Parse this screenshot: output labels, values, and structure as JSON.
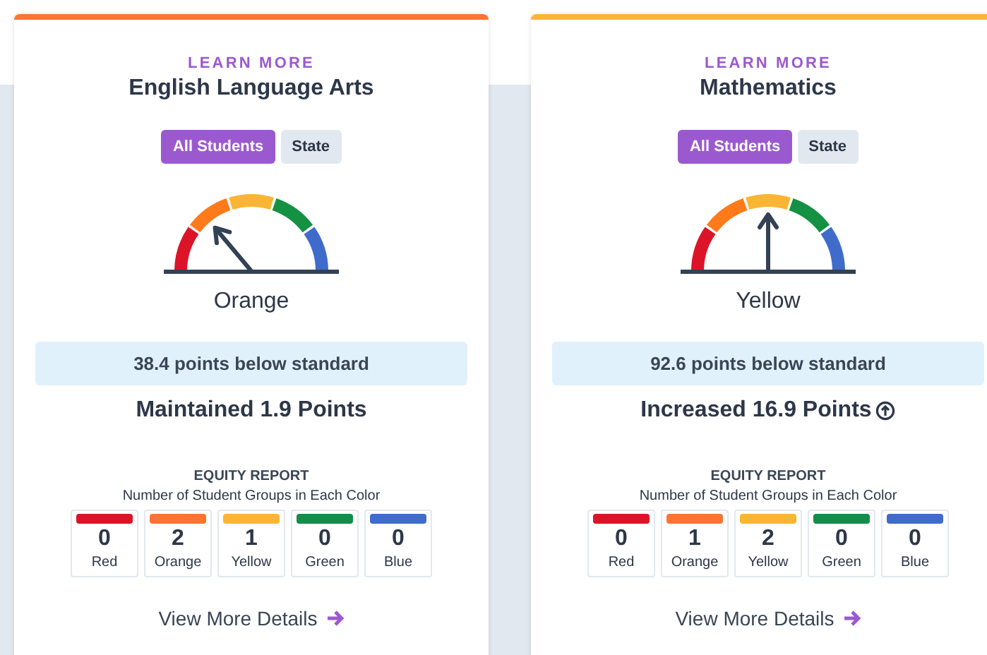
{
  "cards": [
    {
      "color": "#ff7433",
      "link": "LEARN MORE",
      "title": "English Language Arts",
      "toggles": [
        {
          "label": "All Students",
          "selected": true
        },
        {
          "label": "State",
          "selected": false
        }
      ],
      "gauge": {
        "kind": "orange"
      },
      "status": "Orange",
      "distance": "38.4 points below standard",
      "change": {
        "kind": "maintained",
        "text": "Maintained 1.9 Points"
      },
      "equity_title": "EQUITY REPORT",
      "equity_subtitle": "Number of Student Groups in Each Color",
      "groups": [
        {
          "color": "#dc1428",
          "count": "0",
          "label": "Red"
        },
        {
          "color": "#ff7433",
          "count": "2",
          "label": "Orange"
        },
        {
          "color": "#fbb534",
          "count": "1",
          "label": "Yellow"
        },
        {
          "color": "#138d4a",
          "count": "0",
          "label": "Green"
        },
        {
          "color": "#3f6ccb",
          "count": "0",
          "label": "Blue"
        }
      ],
      "details": "View More Details"
    },
    {
      "color": "#fbb534",
      "link": "LEARN MORE",
      "title": "Mathematics",
      "toggles": [
        {
          "label": "All Students",
          "selected": true
        },
        {
          "label": "State",
          "selected": false
        }
      ],
      "gauge": {
        "kind": "yellow"
      },
      "status": "Yellow",
      "distance": "92.6 points below standard",
      "change": {
        "kind": "increased",
        "text": "Increased 16.9 Points"
      },
      "equity_title": "EQUITY REPORT",
      "equity_subtitle": "Number of Student Groups in Each Color",
      "groups": [
        {
          "color": "#dc1428",
          "count": "0",
          "label": "Red"
        },
        {
          "color": "#ff7433",
          "count": "1",
          "label": "Orange"
        },
        {
          "color": "#fbb534",
          "count": "2",
          "label": "Yellow"
        },
        {
          "color": "#138d4a",
          "count": "0",
          "label": "Green"
        },
        {
          "color": "#3f6ccb",
          "count": "0",
          "label": "Blue"
        }
      ],
      "details": "View More Details"
    }
  ]
}
